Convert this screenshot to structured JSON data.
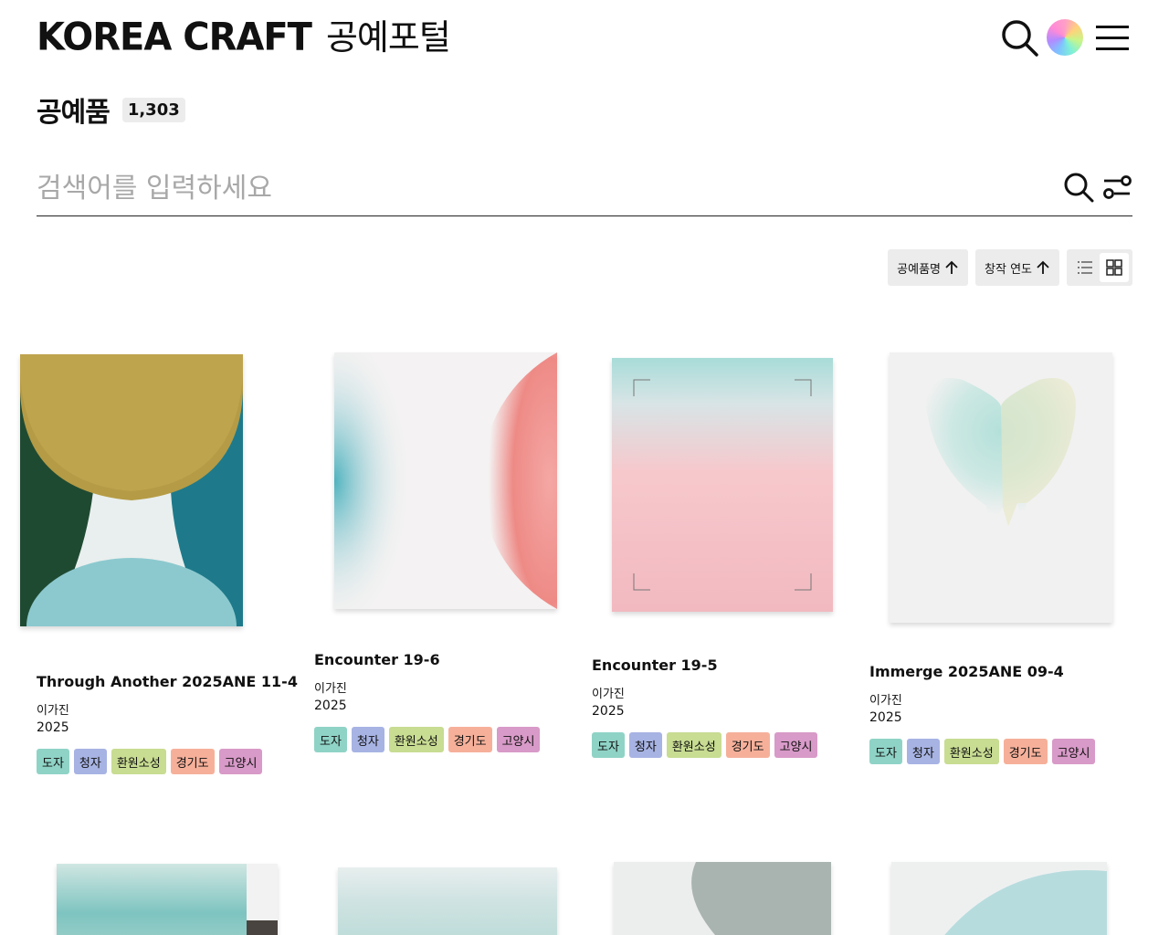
{
  "header": {
    "logo_en": "KOREA CRAFT",
    "logo_ko": "공예포털",
    "search_icon": "search-icon",
    "color_icon": "color-wheel-icon",
    "menu_icon": "hamburger-menu-icon"
  },
  "page": {
    "title": "공예품",
    "count": "1,303"
  },
  "search": {
    "placeholder": "검색어를 입력하세요",
    "value": ""
  },
  "sort": {
    "name_label": "공예품명",
    "year_label": "창작 연도",
    "view_modes": [
      "list",
      "grid"
    ],
    "active_view": "grid"
  },
  "cards": [
    {
      "title": "Through Another 2025ANE 11-4",
      "artist": "이가진",
      "year": "2025",
      "tags": [
        "도자",
        "청자",
        "환원소성",
        "경기도",
        "고양시"
      ]
    },
    {
      "title": "Encounter 19-6",
      "artist": "이가진",
      "year": "2025",
      "tags": [
        "도자",
        "청자",
        "환원소성",
        "경기도",
        "고양시"
      ]
    },
    {
      "title": "Encounter 19-5",
      "artist": "이가진",
      "year": "2025",
      "tags": [
        "도자",
        "청자",
        "환원소성",
        "경기도",
        "고양시"
      ]
    },
    {
      "title": "Immerge 2025ANE 09-4",
      "artist": "이가진",
      "year": "2025",
      "tags": [
        "도자",
        "청자",
        "환원소성",
        "경기도",
        "고양시"
      ]
    }
  ],
  "colors": {
    "tag_1": "#8fd3c6",
    "tag_2": "#a7b3e3",
    "tag_3": "#c8dc92",
    "tag_4": "#f6b09a",
    "tag_5": "#d89ac8"
  }
}
